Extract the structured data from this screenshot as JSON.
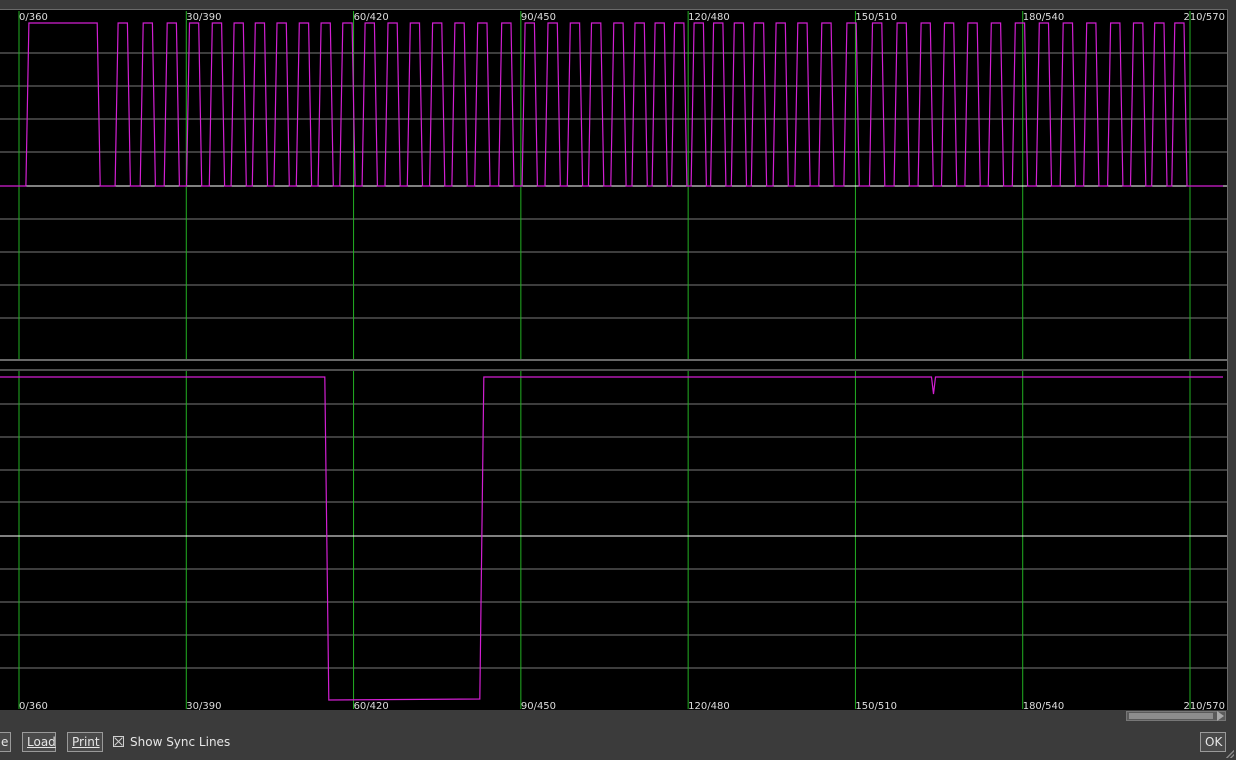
{
  "scope": {
    "tick_labels": [
      "0/360",
      "30/390",
      "60/420",
      "90/450",
      "120/480",
      "150/510",
      "180/540",
      "210/570"
    ],
    "tick_angles": [
      0,
      30,
      60,
      90,
      120,
      150,
      180,
      210
    ],
    "angle_range": [
      0,
      210
    ],
    "colors": {
      "background": "#000000",
      "grid": "#7a7a7a",
      "sync_line": "#22b022",
      "trace": "#d21fd2",
      "baseline": "#ffffff",
      "label": "#dddddd"
    },
    "trace1_pulses": [
      [
        1.5,
        14.3
      ],
      [
        17.5,
        19.7
      ],
      [
        22.0,
        24.2
      ],
      [
        26.3,
        28.5
      ],
      [
        30.3,
        32.5
      ],
      [
        34.4,
        36.6
      ],
      [
        38.3,
        40.5
      ],
      [
        42.1,
        44.3
      ],
      [
        46.0,
        48.2
      ],
      [
        50.0,
        52.2
      ],
      [
        53.9,
        56.1
      ],
      [
        57.8,
        60.0
      ],
      [
        61.8,
        64.0
      ],
      [
        65.9,
        68.1
      ],
      [
        69.9,
        72.1
      ],
      [
        73.9,
        76.1
      ],
      [
        77.9,
        80.1
      ],
      [
        82.0,
        84.2
      ],
      [
        86.3,
        88.5
      ],
      [
        90.5,
        92.7
      ],
      [
        94.6,
        96.8
      ],
      [
        98.6,
        100.8
      ],
      [
        102.4,
        104.6
      ],
      [
        106.4,
        108.6
      ],
      [
        110.2,
        112.4
      ],
      [
        113.8,
        116.0
      ],
      [
        117.3,
        119.5
      ],
      [
        120.8,
        123.0
      ],
      [
        124.3,
        126.5
      ],
      [
        128.0,
        130.2
      ],
      [
        131.6,
        133.8
      ],
      [
        135.5,
        137.7
      ],
      [
        139.4,
        141.6
      ],
      [
        143.7,
        145.9
      ],
      [
        148.2,
        150.4
      ],
      [
        152.8,
        155.0
      ],
      [
        157.2,
        159.4
      ],
      [
        161.5,
        163.7
      ],
      [
        165.7,
        167.9
      ],
      [
        169.9,
        172.1
      ],
      [
        174.1,
        176.3
      ],
      [
        178.4,
        180.6
      ],
      [
        182.7,
        184.9
      ],
      [
        187.0,
        189.2
      ],
      [
        191.2,
        193.4
      ],
      [
        195.5,
        197.7
      ],
      [
        199.6,
        201.8
      ],
      [
        203.4,
        205.6
      ],
      [
        207.0,
        209.2
      ]
    ],
    "trace2_drop": [
      55.2,
      83.0
    ],
    "trace2_glitch": 164
  },
  "toolbar": {
    "save_label": "e",
    "load_label": "Load",
    "print_label": "Print",
    "sync_label": "Show Sync Lines",
    "sync_checked": true,
    "ok_label": "OK"
  }
}
